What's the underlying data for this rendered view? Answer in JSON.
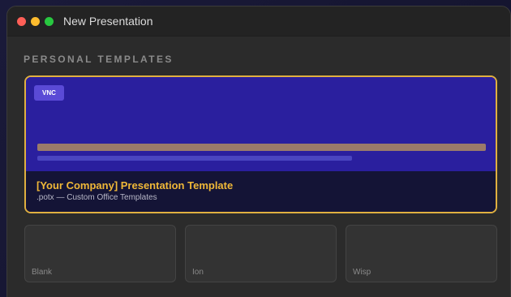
{
  "window": {
    "title": "New Presentation"
  },
  "section": {
    "label": "PERSONAL TEMPLATES"
  },
  "featured_template": {
    "badge": "VNC",
    "title": "[Your Company] Presentation Template",
    "subtitle": ".potx — Custom Office Templates",
    "accent_color": "#e0b040",
    "preview_color": "#2a1f9e"
  },
  "templates": [
    {
      "name": "Blank"
    },
    {
      "name": "Ion"
    },
    {
      "name": "Wisp"
    }
  ]
}
